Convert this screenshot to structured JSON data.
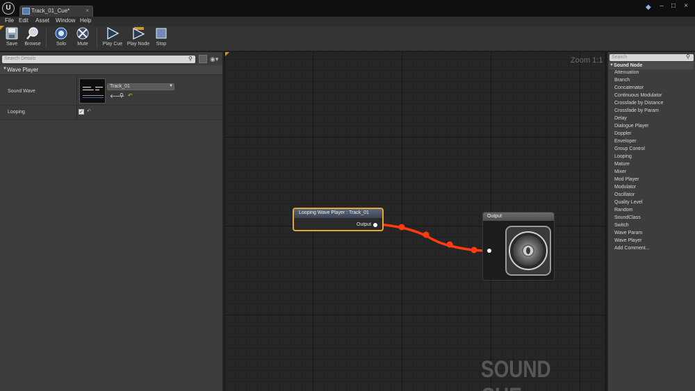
{
  "window": {
    "tab_title": "Track_01_Cue*",
    "close_glyph": "×",
    "controls": {
      "minimize": "–",
      "maximize": "□",
      "close": "×"
    }
  },
  "menu": [
    "File",
    "Edit",
    "Asset",
    "Window",
    "Help"
  ],
  "toolbar": {
    "buttons": [
      {
        "label": "Save",
        "icon": "save-icon"
      },
      {
        "label": "Browse",
        "icon": "browse-icon"
      },
      {
        "label": "Solo",
        "icon": "solo-icon"
      },
      {
        "label": "Mute",
        "icon": "mute-icon"
      },
      {
        "label": "Play Cue",
        "icon": "play-cue-icon"
      },
      {
        "label": "Play Node",
        "icon": "play-node-icon"
      },
      {
        "label": "Stop",
        "icon": "stop-icon"
      }
    ]
  },
  "details": {
    "search_placeholder": "Search Details",
    "category": "Wave Player",
    "properties": {
      "sound_wave": {
        "label": "Sound Wave",
        "value": "Track_01"
      },
      "looping": {
        "label": "Looping",
        "checked": true
      }
    }
  },
  "graph": {
    "zoom": "Zoom 1:1",
    "watermark": "SOUND CUE",
    "wire_color": "#ff3b0f",
    "nodes": {
      "wave_player": {
        "title": "Looping Wave Player : Track_01",
        "output_label": "Output",
        "selected_color": "#e6a635"
      },
      "output": {
        "title": "Output"
      }
    }
  },
  "palette": {
    "search_placeholder": "Search",
    "category": "Sound Node",
    "items": [
      "Attenuation",
      "Branch",
      "Concatenator",
      "Continuous Modulator",
      "Crossfade by Distance",
      "Crossfade by Param",
      "Delay",
      "Dialogue Player",
      "Doppler",
      "Enveloper",
      "Group Control",
      "Looping",
      "Mature",
      "Mixer",
      "Mod Player",
      "Modulator",
      "Oscillator",
      "Quality Level",
      "Random",
      "SoundClass",
      "Switch",
      "Wave Param",
      "Wave Player",
      "Add Comment..."
    ]
  }
}
